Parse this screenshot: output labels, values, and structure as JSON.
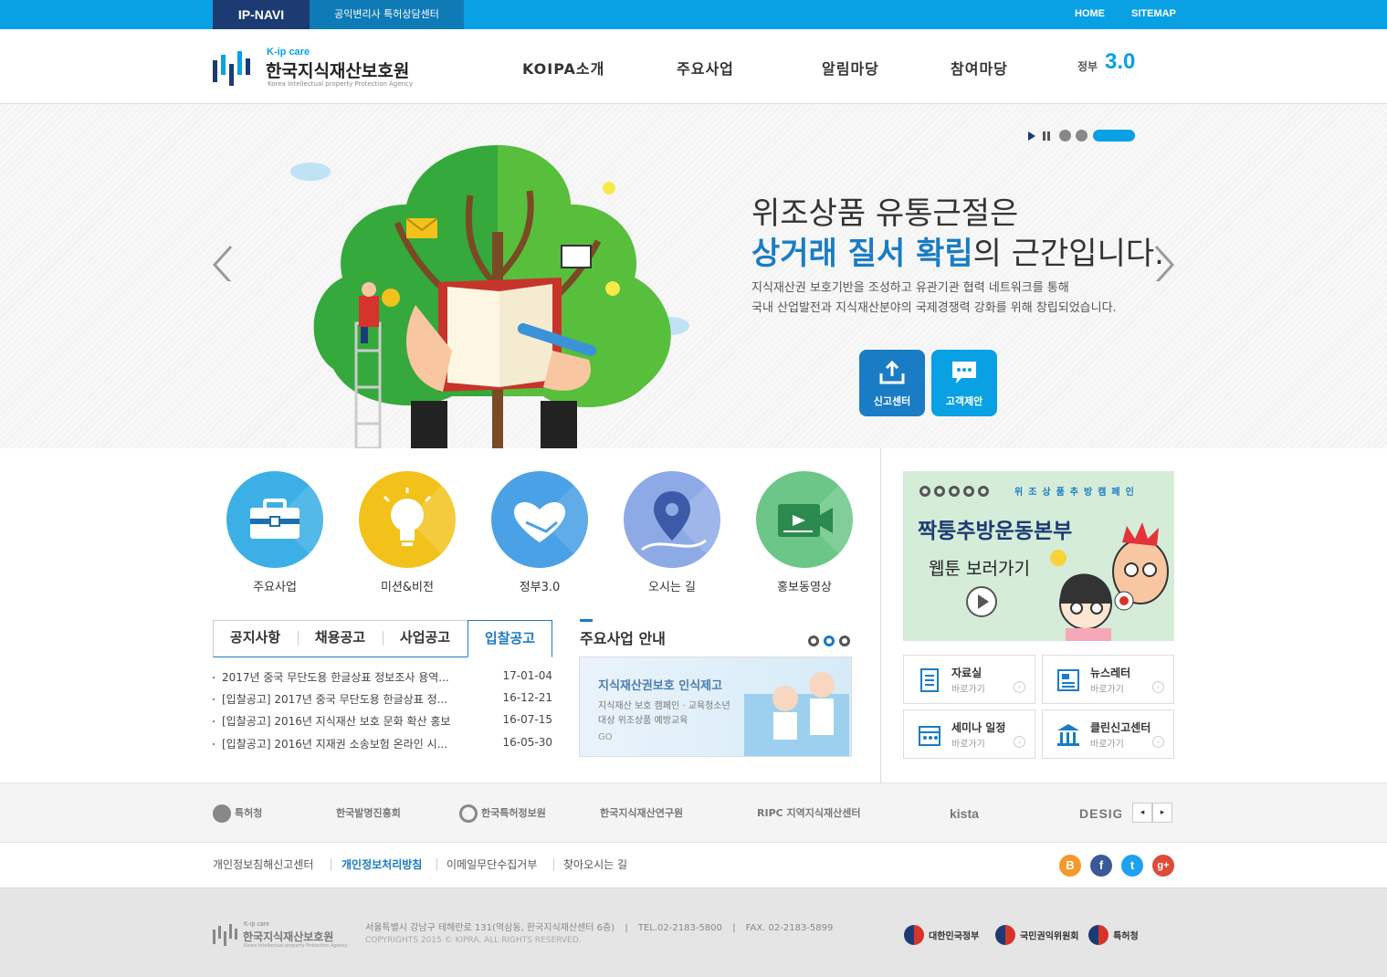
{
  "top_bar": {
    "ipnavi": "IP-NAVI",
    "patent_center": "공익변리사 특허상담센터",
    "home": "HOME",
    "sitemap": "SITEMAP"
  },
  "header": {
    "logo_sub": "K-ip care",
    "logo_title": "한국지식재산보호원",
    "logo_en": "Korea Intellectual property Protection Agency",
    "nav": [
      "KOIPA소개",
      "주요사업",
      "알림마당",
      "참여마당"
    ],
    "gov_badge_text": "정부",
    "gov_badge_num": "3.0"
  },
  "hero": {
    "line1": "위조상품 유통근절은",
    "line2_highlight": "상거래 질서 확립",
    "line2_rest": "의 근간입니다.",
    "desc1": "지식재산권 보호기반을 조성하고 유관기관 협력 네트워크를 통해",
    "desc2": "국내 산업발전과 지식재산분야의 국제경쟁력 강화를 위해 창립되었습니다.",
    "quick1": "신고센터",
    "quick2": "고객제안",
    "accent": "#1a7cc4"
  },
  "circles": [
    {
      "label": "주요사업",
      "icon": "briefcase-icon",
      "color": "#3cb0e6"
    },
    {
      "label": "미션&비전",
      "icon": "lightbulb-icon",
      "color": "#f2c21b"
    },
    {
      "label": "정부3.0",
      "icon": "handshake-icon",
      "color": "#4aa1e6"
    },
    {
      "label": "오시는 길",
      "icon": "map-pin-icon",
      "color": "#8eaae6"
    },
    {
      "label": "홍보동영상",
      "icon": "video-icon",
      "color": "#6cc688"
    }
  ],
  "notice": {
    "tabs": [
      "공지사항",
      "채용공고",
      "사업공고",
      "입찰공고"
    ],
    "active_tab": "입찰공고",
    "rows": [
      {
        "title": "2017년 중국 무단도용 한글상표 정보조사 용역...",
        "date": "17-01-04"
      },
      {
        "title": "[입찰공고] 2017년 중국 무단도용 한글상표 정...",
        "date": "16-12-21"
      },
      {
        "title": "[입찰공고] 2016년 지식재산 보호 문화 확산 홍보",
        "date": "16-07-15"
      },
      {
        "title": "[입찰공고] 2016년 지재권 소송보험 온라인 시...",
        "date": "16-05-30"
      }
    ]
  },
  "business": {
    "title": "주요사업 안내",
    "banner_title": "지식재산권보호 인식제고",
    "banner_line1": "지식재산 보호 캠페인 · 교육청소년",
    "banner_line2": "대상 위조상품 예방교육",
    "banner_go": "GO"
  },
  "webtoon": {
    "campaign": "위조상품추방캠페인",
    "title": "짝퉁추방운동본부",
    "subtitle": "웹툰 보러가기"
  },
  "quick_boxes": [
    {
      "title": "자료실",
      "sub": "바로가기",
      "icon": "document-icon"
    },
    {
      "title": "뉴스레터",
      "sub": "바로가기",
      "icon": "newsletter-icon"
    },
    {
      "title": "세미나 일정",
      "sub": "바로가기",
      "icon": "calendar-icon"
    },
    {
      "title": "클린신고센터",
      "sub": "바로가기",
      "icon": "building-icon"
    }
  ],
  "partners": [
    "특허청",
    "한국발명진흥회",
    "한국특허정보원",
    "한국지식재산연구원",
    "RIPC 지역지식재산센터",
    "kista",
    "DESIGN"
  ],
  "footer_links": [
    "개인정보침해신고센터",
    "개인정보처리방침",
    "이메일무단수집거부",
    "찾아오시는 길"
  ],
  "footer": {
    "address": "서울특별시 강남구 테헤란로 131(역삼동, 한국지식재산센터 6층)",
    "tel": "TEL.02-2183-5800",
    "fax": "FAX. 02-2183-5899",
    "copyright": "COPYRIGHTS 2015 © KIPRA. ALL RIGHTS RESERVED.",
    "gov_logos": [
      "대한민국정부",
      "국민권익위원회",
      "특허청"
    ]
  }
}
